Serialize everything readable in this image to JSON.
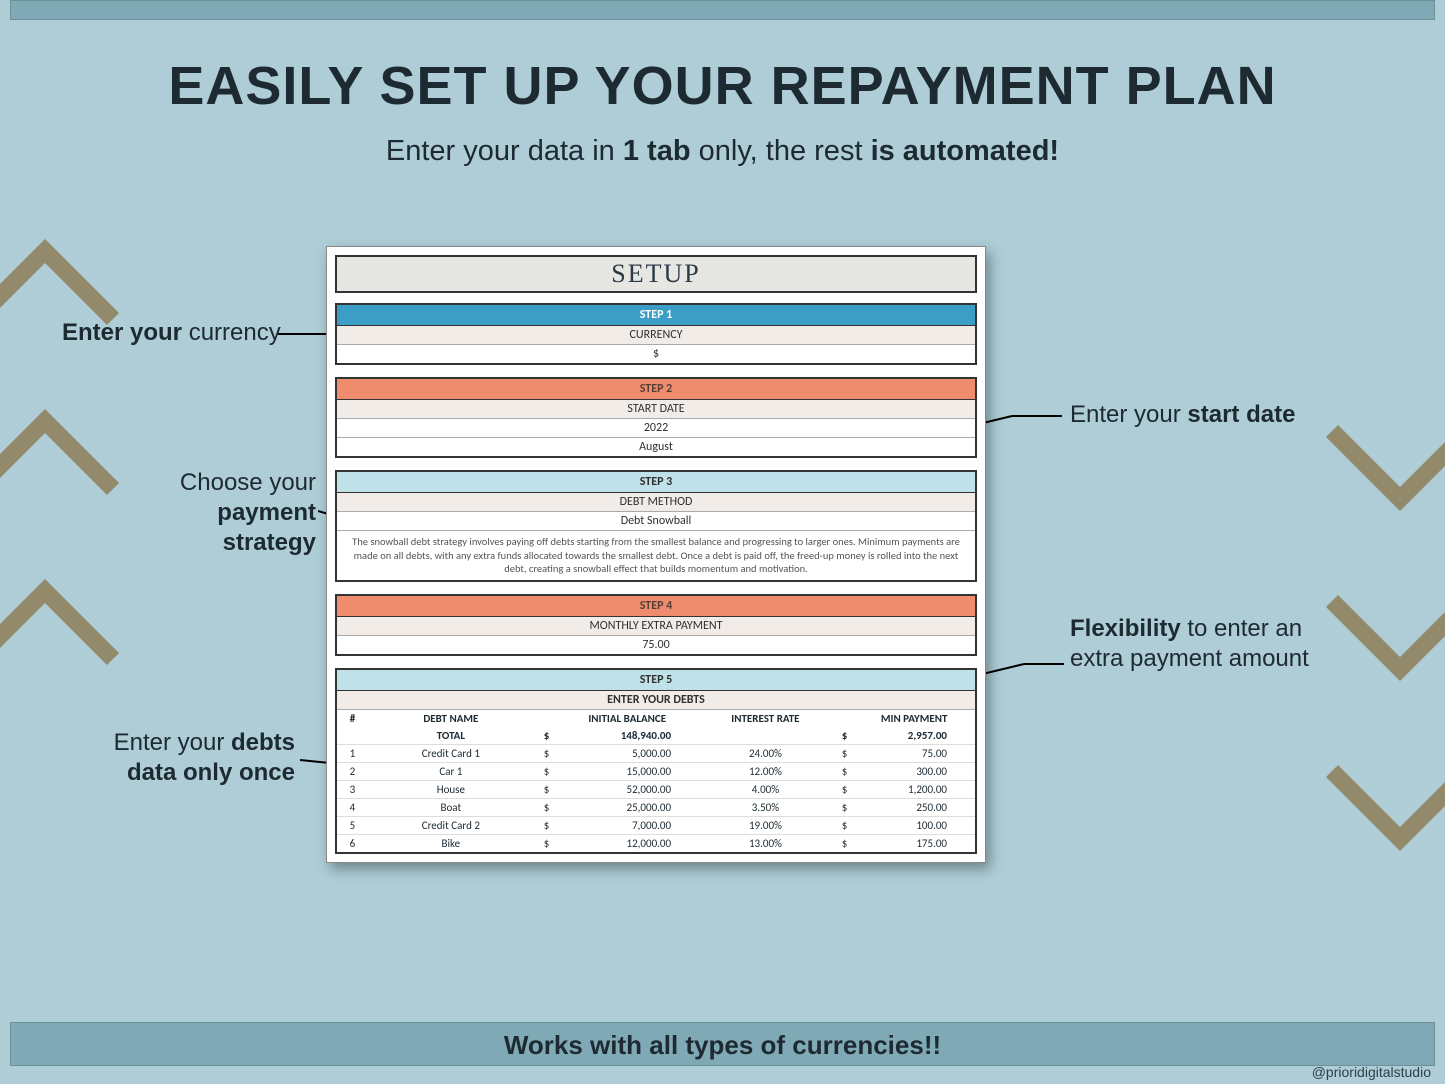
{
  "headline": "EASILY SET UP YOUR REPAYMENT PLAN",
  "subhead_parts": {
    "a": "Enter your data in ",
    "b": "1 tab",
    "c": " only, the rest ",
    "d": "is automated!"
  },
  "callouts": {
    "currency_bold": "Enter your",
    "currency_rest": " currency",
    "strategy_a": "Choose your",
    "strategy_b": "payment strategy",
    "startdate_a": "Enter your ",
    "startdate_b": "start date",
    "extra_a": "Flexibility",
    "extra_b": " to enter an extra payment amount",
    "debts_a": "Enter your ",
    "debts_b": "debts data only once"
  },
  "sheet": {
    "title": "SETUP",
    "step1": {
      "hdr": "STEP 1",
      "label": "CURRENCY",
      "value": "$"
    },
    "step2": {
      "hdr": "STEP 2",
      "label": "START DATE",
      "year": "2022",
      "month": "August"
    },
    "step3": {
      "hdr": "STEP 3",
      "label": "DEBT METHOD",
      "value": "Debt Snowball",
      "desc": "The snowball debt strategy involves paying off debts starting from the smallest balance and progressing to larger ones. Minimum payments are made on all debts, with any extra funds allocated towards the smallest debt. Once a debt is paid off, the freed-up money is rolled into the next debt, creating a snowball effect that builds momentum and motivation."
    },
    "step4": {
      "hdr": "STEP 4",
      "label": "MONTHLY EXTRA PAYMENT",
      "value": "75.00"
    },
    "step5": {
      "hdr": "STEP 5",
      "sub": "ENTER YOUR DEBTS",
      "cols": {
        "idx": "#",
        "name": "DEBT NAME",
        "bal": "INITIAL BALANCE",
        "rate": "INTEREST RATE",
        "min": "MIN PAYMENT"
      },
      "total_label": "TOTAL",
      "total_bal": "148,940.00",
      "total_min": "2,957.00",
      "cur": "$",
      "rows": [
        {
          "i": "1",
          "name": "Credit Card 1",
          "bal": "5,000.00",
          "rate": "24.00%",
          "min": "75.00"
        },
        {
          "i": "2",
          "name": "Car 1",
          "bal": "15,000.00",
          "rate": "12.00%",
          "min": "300.00"
        },
        {
          "i": "3",
          "name": "House",
          "bal": "52,000.00",
          "rate": "4.00%",
          "min": "1,200.00"
        },
        {
          "i": "4",
          "name": "Boat",
          "bal": "25,000.00",
          "rate": "3.50%",
          "min": "250.00"
        },
        {
          "i": "5",
          "name": "Credit Card 2",
          "bal": "7,000.00",
          "rate": "19.00%",
          "min": "100.00"
        },
        {
          "i": "6",
          "name": "Bike",
          "bal": "12,000.00",
          "rate": "13.00%",
          "min": "175.00"
        }
      ]
    }
  },
  "bottombar": "Works with all types of currencies!!",
  "handle": "@prioridigitalstudio"
}
